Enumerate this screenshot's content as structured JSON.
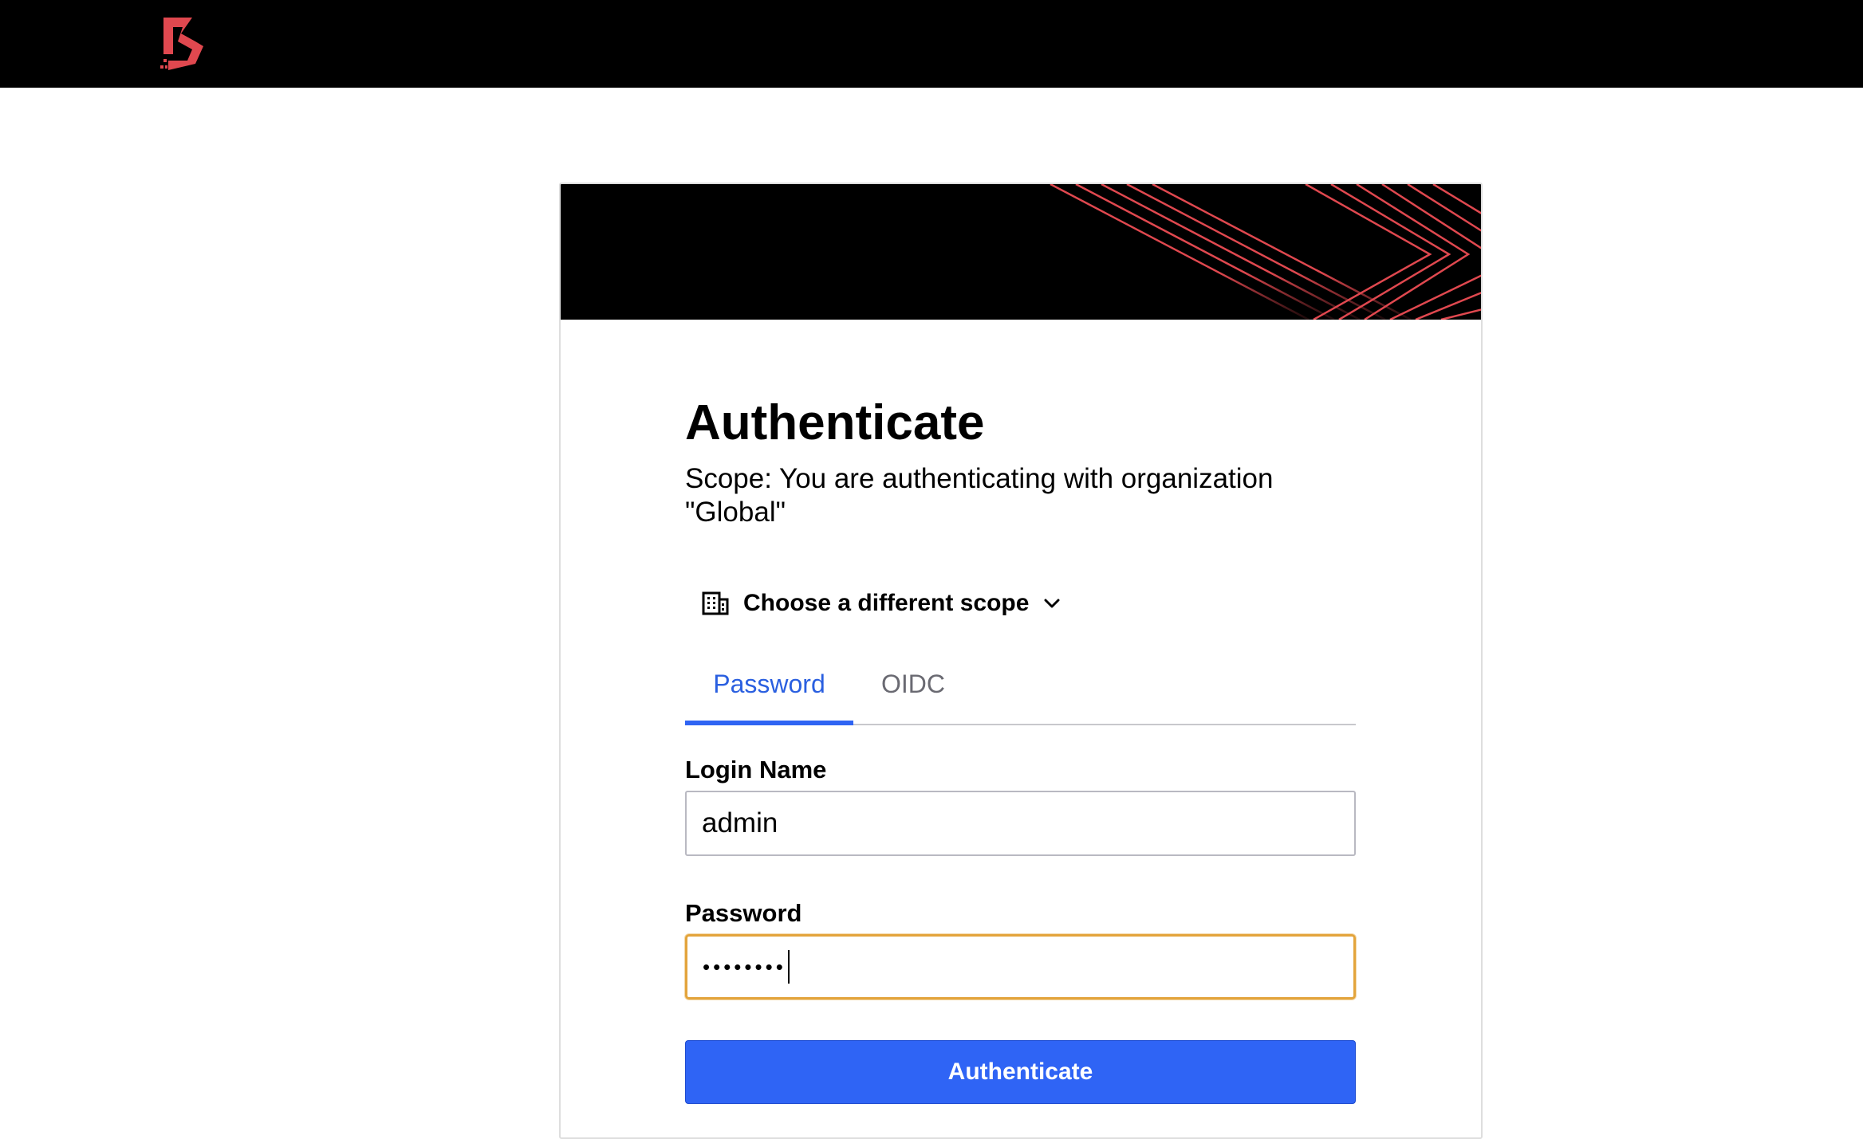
{
  "header": {
    "logo_icon": "boundary-logo-icon",
    "accent_color": "#e0484f"
  },
  "auth": {
    "title": "Authenticate",
    "scope_text": "Scope: You are authenticating with organization \"Global\"",
    "scope_picker": {
      "icon": "building-icon",
      "label": "Choose a different scope",
      "chevron_icon": "chevron-down-icon"
    },
    "tabs": [
      {
        "label": "Password",
        "active": true
      },
      {
        "label": "OIDC",
        "active": false
      }
    ],
    "login_name": {
      "label": "Login Name",
      "value": "admin"
    },
    "password": {
      "label": "Password",
      "masked_value": "••••••••"
    },
    "submit_label": "Authenticate",
    "colors": {
      "primary": "#2f64f5",
      "active_tab": "#2a5fe0",
      "focus_border": "#e3a43c",
      "banner_lines": "#e0484f"
    }
  }
}
